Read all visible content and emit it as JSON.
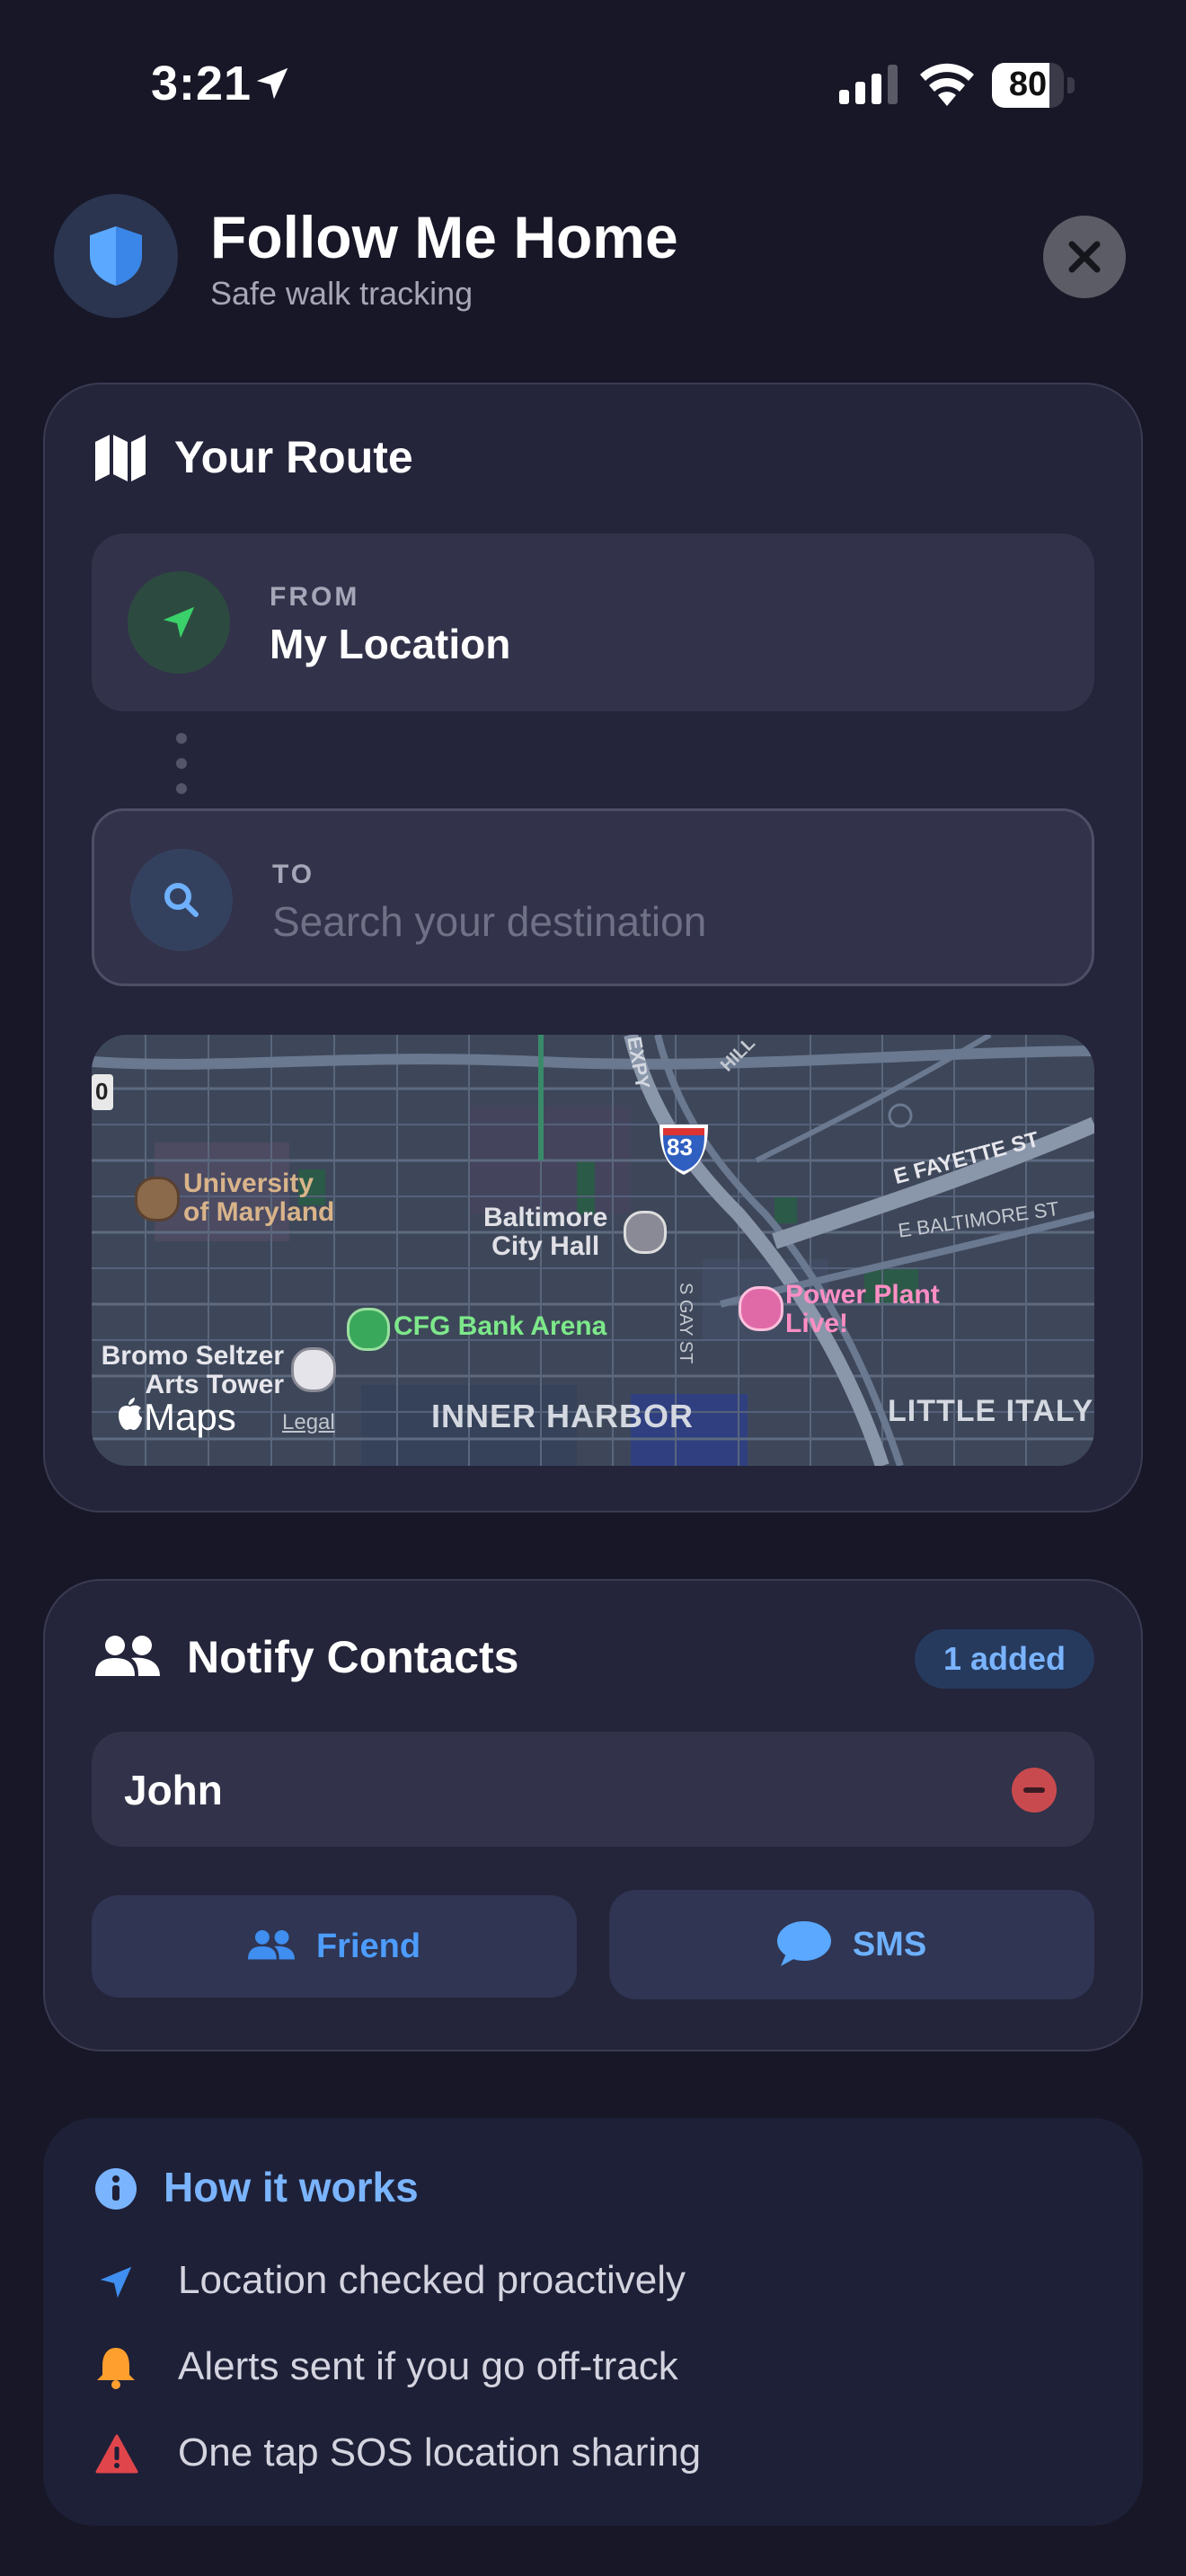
{
  "status_bar": {
    "time": "3:21",
    "battery": "80",
    "battery_level": 0.8,
    "icons": [
      "location-arrow-icon",
      "cellular-signal-icon",
      "wifi-icon",
      "battery-icon"
    ]
  },
  "header": {
    "title": "Follow Me Home",
    "subtitle": "Safe walk tracking",
    "badge_icon": "shield-icon",
    "close_icon": "close-icon"
  },
  "route": {
    "title": "Your Route",
    "icon": "map-icon",
    "from": {
      "label": "FROM",
      "value": "My Location",
      "icon": "location-arrow-icon"
    },
    "to": {
      "label": "TO",
      "placeholder": "Search your destination",
      "value": "",
      "icon": "search-icon"
    },
    "map": {
      "labels": {
        "university": "University\nof Maryland",
        "city_hall": "Baltimore\nCity Hall",
        "arena": "CFG Bank Arena",
        "power_plant": "Power Plant\nLive!",
        "bromo": "Bromo Seltzer\nArts Tower",
        "inner_harbor": "INNER HARBOR",
        "little_italy": "LITTLE ITALY",
        "fayette": "E FAYETTE ST",
        "baltimore_st": "E BALTIMORE ST",
        "gay_st": "S GAY ST",
        "expy": "EXPY",
        "hill": "HILL",
        "interstate": "83",
        "edge_shield": "0"
      },
      "brand": "Maps",
      "legal": "Legal"
    }
  },
  "contacts": {
    "title": "Notify Contacts",
    "icon": "people-icon",
    "count_badge": "1 added",
    "items": [
      {
        "name": "John"
      }
    ],
    "buttons": {
      "friend": "Friend",
      "sms": "SMS"
    }
  },
  "info": {
    "title": "How it works",
    "icon": "info-icon",
    "items": [
      {
        "text": "Location checked proactively",
        "icon": "location-arrow-icon"
      },
      {
        "text": "Alerts sent if you go off-track",
        "icon": "bell-icon"
      },
      {
        "text": "One tap SOS location sharing",
        "icon": "warning-icon"
      }
    ]
  },
  "colors": {
    "background": "#171727",
    "card": "#24243a",
    "accent_blue": "#4d9cff",
    "accent_green": "#4cd964",
    "danger": "#e0454b",
    "warning_orange": "#ff9f2e"
  }
}
